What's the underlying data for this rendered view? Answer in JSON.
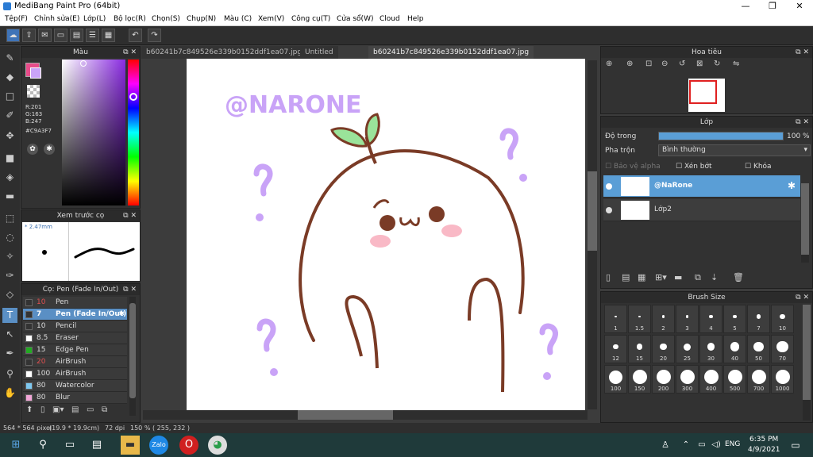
{
  "window": {
    "title": "MediBang Paint Pro (64bit)",
    "min": "—",
    "max": "❐",
    "close": "✕"
  },
  "menu": [
    "Tệp(F)",
    "Chỉnh sửa(E)",
    "Lớp(L)",
    "Bộ lọc(R)",
    "Chọn(S)",
    "Chụp(N)",
    "Màu (C)",
    "Xem(V)",
    "Công cụ(T)",
    "Cửa sổ(W)",
    "Cloud",
    "Help"
  ],
  "color_panel": {
    "title": "Màu",
    "r": "R:201",
    "g": "G:163",
    "b": "B:247",
    "hex": "#C9A3F7",
    "accent": "#C9A3F7"
  },
  "brush_preview": {
    "title": "Xem trước cọ",
    "size": "* 2.47mm"
  },
  "brush_list": {
    "title": "Cọ: Pen (Fade In/Out)",
    "items": [
      {
        "size": "10",
        "name": "Pen",
        "color": "#333333",
        "size_red": true
      },
      {
        "size": "7",
        "name": "Pen (Fade In/Out)",
        "color": "#333333",
        "size_red": true
      },
      {
        "size": "10",
        "name": "Pencil",
        "color": "#333333",
        "size_red": false
      },
      {
        "size": "8.5",
        "name": "Eraser",
        "color": "#ffffff",
        "size_red": false
      },
      {
        "size": "15",
        "name": "Edge Pen",
        "color": "#22aa22",
        "size_red": false
      },
      {
        "size": "20",
        "name": "AirBrush",
        "color": "#333333",
        "size_red": true
      },
      {
        "size": "100",
        "name": "AirBrush",
        "color": "#ffffff",
        "size_red": false
      },
      {
        "size": "80",
        "name": "Watercolor",
        "color": "#7ec8f0",
        "size_red": false
      },
      {
        "size": "80",
        "name": "Blur",
        "color": "#f2a6d8",
        "size_red": false
      }
    ]
  },
  "doc_tabs": [
    "b60241b7c849526e339b0152ddf1ea07.jpg",
    "Untitled",
    "b60241b7c849526e339b0152ddf1ea07.jpg"
  ],
  "artwork": {
    "signature": "@NARONE"
  },
  "navigator": {
    "title": "Hoa tiêu"
  },
  "layers": {
    "title": "Lớp",
    "opacity_label": "Độ trong",
    "opacity_value": "100 %",
    "opacity_fraction": 1.0,
    "blend_label": "Pha trộn",
    "blend_value": "Bình thường",
    "protect_alpha": "Bảo vệ alpha",
    "clip": "Xén bớt",
    "lock": "Khóa",
    "items": [
      {
        "name": "@NaRone"
      },
      {
        "name": "Lớp2"
      }
    ]
  },
  "brush_size": {
    "title": "Brush Size",
    "sizes": [
      "1",
      "1.5",
      "2",
      "3",
      "4",
      "5",
      "7",
      "10",
      "12",
      "15",
      "20",
      "25",
      "30",
      "40",
      "50",
      "70",
      "100",
      "150",
      "200",
      "300",
      "400",
      "500",
      "700",
      "1000"
    ]
  },
  "status": {
    "dims": "564 * 564 pixel",
    "cm": "(19.9 * 19.9cm)",
    "dpi": "72 dpi",
    "zoom": "150 %",
    "coords": "( 255, 232 )"
  },
  "taskbar": {
    "lang": "ENG",
    "time": "6:35 PM",
    "date": "4/9/2021"
  }
}
